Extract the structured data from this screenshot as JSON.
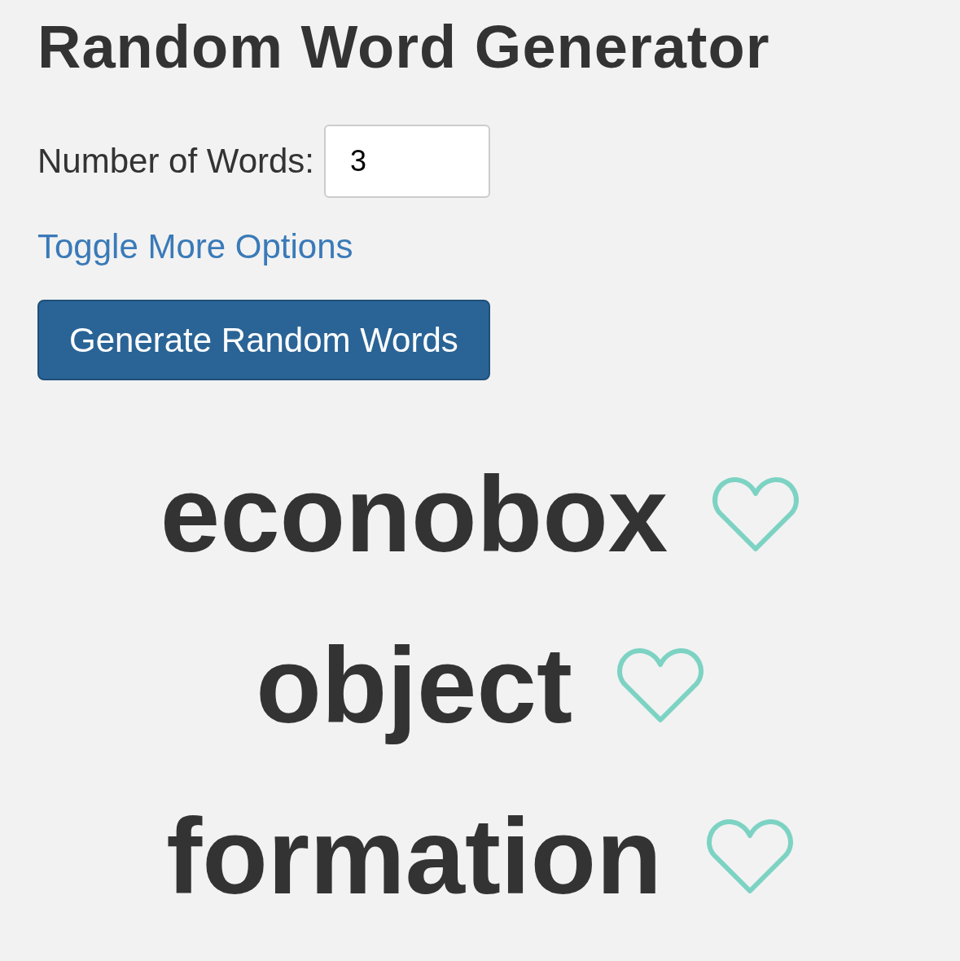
{
  "title": "Random Word Generator",
  "count_field": {
    "label": "Number of Words:",
    "value": "3"
  },
  "options_link": "Toggle More Options",
  "generate_button": "Generate Random Words",
  "words": [
    {
      "text": "econobox",
      "favorite": false
    },
    {
      "text": "object",
      "favorite": false
    },
    {
      "text": "formation",
      "favorite": false
    }
  ]
}
